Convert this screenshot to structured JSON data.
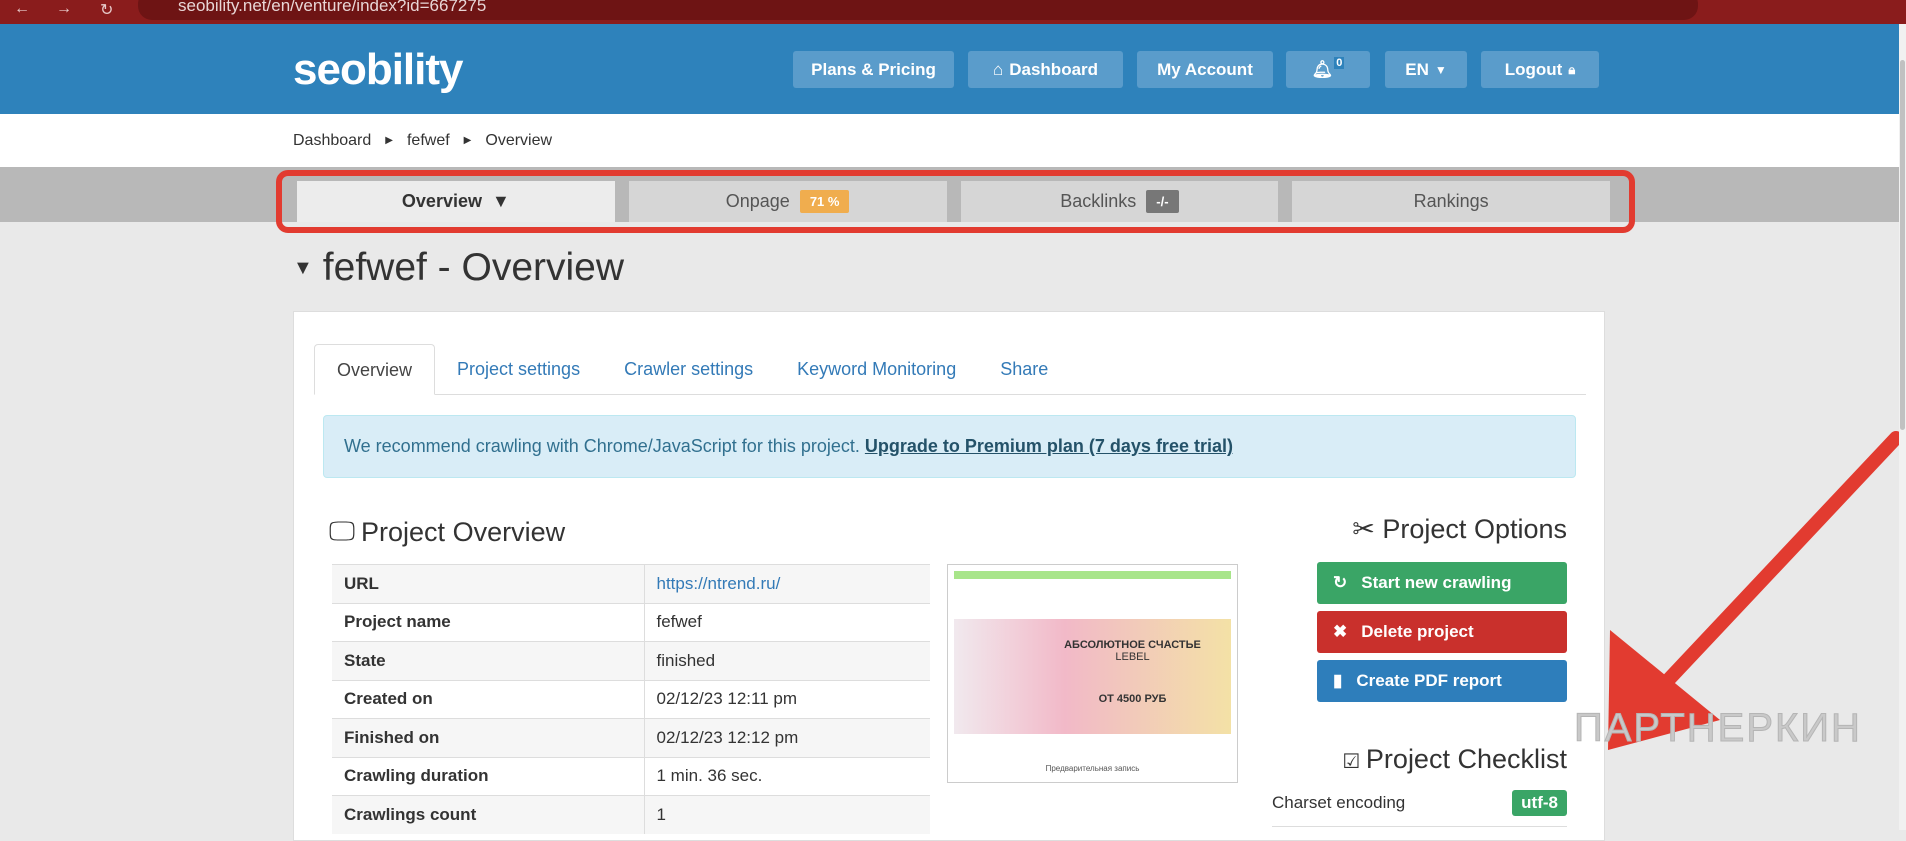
{
  "browser": {
    "url": "seobility.net/en/venture/index?id=667275"
  },
  "header": {
    "logo": "seobility",
    "nav": {
      "plans": "Plans & Pricing",
      "dashboard": "Dashboard",
      "account": "My Account",
      "notifications": "0",
      "language": "EN",
      "logout": "Logout"
    }
  },
  "breadcrumb": [
    "Dashboard",
    "fefwef",
    "Overview"
  ],
  "top_tabs": {
    "overview": "Overview",
    "onpage": "Onpage",
    "onpage_badge": "71 %",
    "backlinks": "Backlinks",
    "backlinks_badge": "-/-",
    "rankings": "Rankings"
  },
  "page_title": "fefwef - Overview",
  "inner_tabs": [
    "Overview",
    "Project settings",
    "Crawler settings",
    "Keyword Monitoring",
    "Share"
  ],
  "alert": {
    "text": "We recommend crawling with Chrome/JavaScript for this project.",
    "link": "Upgrade to Premium plan (7 days free trial)"
  },
  "project_overview": {
    "title": "Project Overview",
    "rows": [
      {
        "label": "URL",
        "value": "https://ntrend.ru/"
      },
      {
        "label": "Project name",
        "value": "fefwef"
      },
      {
        "label": "State",
        "value": "finished"
      },
      {
        "label": "Created on",
        "value": "02/12/23 12:11 pm"
      },
      {
        "label": "Finished on",
        "value": "02/12/23 12:12 pm"
      },
      {
        "label": "Crawling duration",
        "value": "1 min. 36 sec."
      },
      {
        "label": "Crawlings count",
        "value": "1"
      }
    ]
  },
  "preview": {
    "headline": "АБСОЛЮТНОЕ СЧАСТЬЕ",
    "brand": "LEBEL",
    "price": "ОТ 4500 РУБ",
    "footer": "Предварительная запись"
  },
  "options": {
    "title": "Project Options",
    "start": "Start new crawling",
    "delete": "Delete project",
    "pdf": "Create PDF report"
  },
  "checklist": {
    "title": "Project Checklist",
    "items": [
      {
        "label": "Charset encoding",
        "value": "utf-8"
      }
    ]
  },
  "watermark": "ПАРТНЕРКИН",
  "colors": {
    "header": "#2e82bb",
    "green": "#3aa566",
    "red": "#c9302c",
    "blue": "#2e7ebb",
    "orange": "#f0ad4e",
    "annotation": "#e23b30"
  }
}
